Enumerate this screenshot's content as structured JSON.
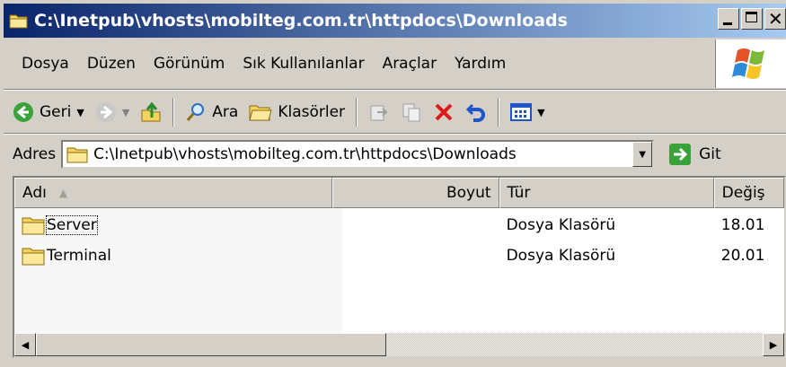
{
  "window": {
    "title": "C:\\Inetpub\\vhosts\\mobilteg.com.tr\\httpdocs\\Downloads"
  },
  "menu": {
    "items": [
      {
        "label": "Dosya"
      },
      {
        "label": "Düzen"
      },
      {
        "label": "Görünüm"
      },
      {
        "label": "Sık Kullanılanlar"
      },
      {
        "label": "Araçlar"
      },
      {
        "label": "Yardım"
      }
    ]
  },
  "toolbar": {
    "back_label": "Geri",
    "search_label": "Ara",
    "folders_label": "Klasörler"
  },
  "address": {
    "label": "Adres",
    "value": "C:\\Inetpub\\vhosts\\mobilteg.com.tr\\httpdocs\\Downloads",
    "go_label": "Git"
  },
  "list": {
    "columns": {
      "name": "Adı",
      "size": "Boyut",
      "type": "Tür",
      "modified": "Değiş"
    },
    "rows": [
      {
        "name": "Server",
        "size": "",
        "type": "Dosya Klasörü",
        "modified": "18.01"
      },
      {
        "name": "Terminal",
        "size": "",
        "type": "Dosya Klasörü",
        "modified": "20.01"
      }
    ]
  },
  "colors": {
    "title_start": "#0a246a",
    "title_end": "#a6caf0",
    "chrome": "#d4d0c8",
    "folder": "#f5d35c"
  }
}
